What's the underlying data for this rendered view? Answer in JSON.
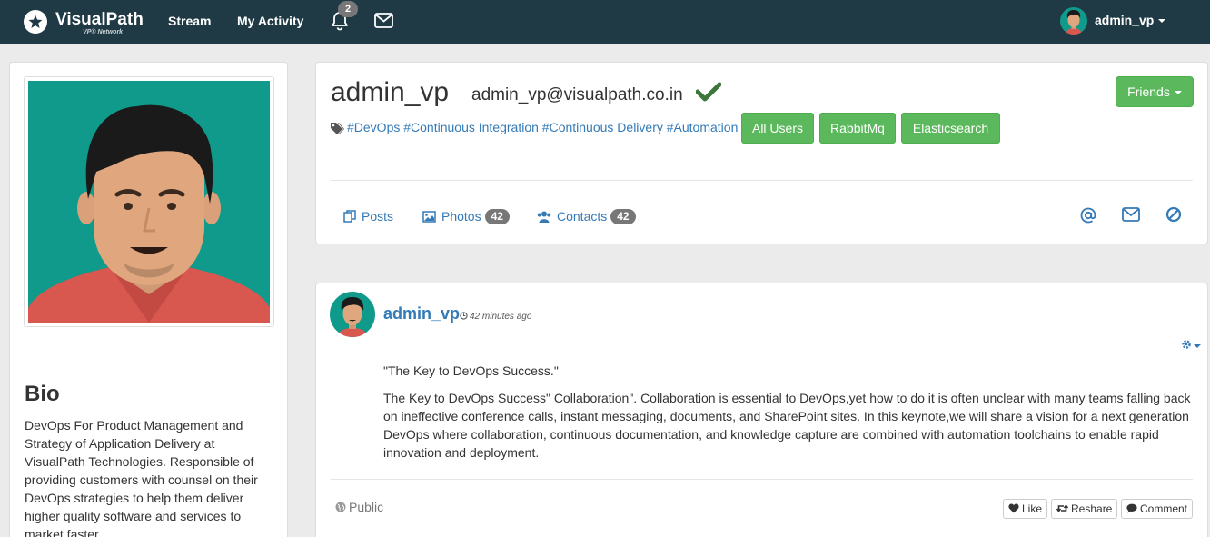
{
  "navbar": {
    "brand": "VisualPath",
    "brand_sub": "VP® Network",
    "links": [
      "Stream",
      "My Activity"
    ],
    "notification_count": "2",
    "username": "admin_vp"
  },
  "profile": {
    "name": "admin_vp",
    "email": "admin_vp@visualpath.co.in",
    "verified": true,
    "friends_button": "Friends",
    "tags": "#DevOps #Continuous Integration #Continuous Delivery #Automation",
    "groups": [
      "All Users",
      "RabbitMq",
      "Elasticsearch"
    ],
    "tabs": {
      "posts": "Posts",
      "photos": "Photos",
      "photos_count": "42",
      "contacts": "Contacts",
      "contacts_count": "42"
    }
  },
  "bio": {
    "title": "Bio",
    "text": "DevOps For Product Management and Strategy of Application Delivery at VisualPath Technologies. Responsible of providing customers with counsel on their DevOps strategies to help them deliver higher quality software and services to market faster."
  },
  "post": {
    "author": "admin_vp",
    "time": "42 minutes ago",
    "title": "\"The Key to DevOps Success.\"",
    "body": "The Key to DevOps Success\" Collaboration\". Collaboration is essential to DevOps,yet how to do it is often unclear with many teams falling back on ineffective conference calls, instant messaging, documents, and SharePoint sites. In this keynote,we will share a vision for a next generation DevOps where collaboration, continuous documentation, and knowledge capture are combined with automation toolchains to enable rapid innovation and deployment.",
    "visibility": "Public",
    "actions": {
      "like": "Like",
      "reshare": "Reshare",
      "comment": "Comment"
    }
  },
  "colors": {
    "navbar": "#1f3a45",
    "link": "#337ab7",
    "success": "#5cb85c",
    "avatar_bg": "#0f9a8b"
  },
  "icons": [
    "star-logo-icon",
    "bell-icon",
    "envelope-icon",
    "tag-icon",
    "check-icon",
    "posts-icon",
    "photo-icon",
    "users-icon",
    "at-icon",
    "ban-icon",
    "clock-icon",
    "gear-icon",
    "globe-icon",
    "heart-icon",
    "retweet-icon",
    "comment-icon"
  ]
}
